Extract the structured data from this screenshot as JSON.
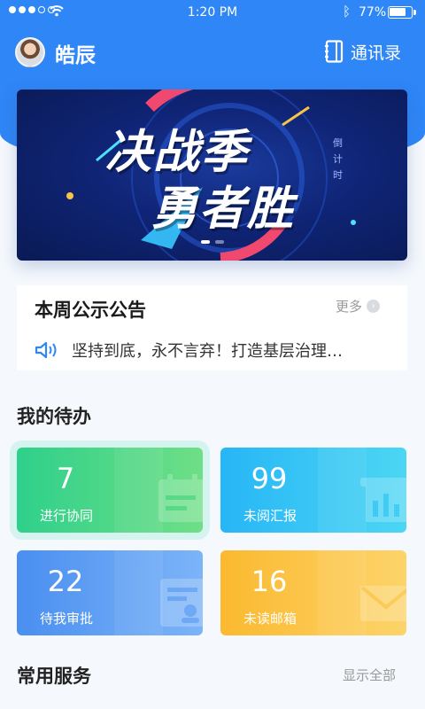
{
  "status_bar": {
    "time": "1:20 PM",
    "battery_text": "77%",
    "battery_level": 0.77,
    "signal_bars_filled": 3,
    "signal_bars_total": 5
  },
  "header": {
    "user_name": "皓辰",
    "contacts_label": "通讯录",
    "background_color": "#2f86f6"
  },
  "banner": {
    "line1": "决战季",
    "line2": "勇者胜",
    "side_text": "倒计时",
    "page_count": 2,
    "active_page": 1
  },
  "notice": {
    "title": "本周公示公告",
    "more_label": "更多",
    "text": "坚持到底，永不言弃！打造基层治理…"
  },
  "todo": {
    "title": "我的待办",
    "items": [
      {
        "count": "7",
        "label": "进行协同",
        "color": "#2ed08b",
        "icon": "calendar-icon"
      },
      {
        "count": "99",
        "label": "未阅汇报",
        "color": "#27b6f6",
        "icon": "report-icon"
      },
      {
        "count": "22",
        "label": "待我审批",
        "color": "#4a8ff0",
        "icon": "approval-icon"
      },
      {
        "count": "16",
        "label": "未读邮箱",
        "color": "#fbb92f",
        "icon": "mail-icon"
      }
    ]
  },
  "services": {
    "title": "常用服务",
    "show_all_label": "显示全部"
  }
}
